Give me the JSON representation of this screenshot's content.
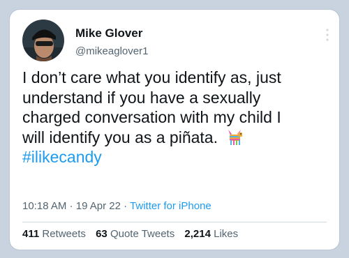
{
  "tweet": {
    "author": {
      "name": "Mike Glover",
      "handle": "@mikeaglover1"
    },
    "text_lines": [
      "I don’t care what you identify as, just",
      "understand if you have a sexually",
      "charged conversation with my child I",
      "will identify you as a piñata."
    ],
    "emoji": "pinata-icon",
    "hashtag": "#ilikecandy",
    "time": "10:18 AM",
    "date": "19 Apr 22",
    "source": "Twitter for iPhone",
    "separator": "·",
    "stats": {
      "retweets": {
        "count": "411",
        "label": "Retweets"
      },
      "quotes": {
        "count": "63",
        "label": "Quote Tweets"
      },
      "likes": {
        "count": "2,214",
        "label": "Likes"
      }
    }
  },
  "colors": {
    "background": "#c8d3df",
    "card": "#ffffff",
    "text": "#0f1419",
    "secondary": "#536471",
    "link": "#1d9bf0"
  }
}
